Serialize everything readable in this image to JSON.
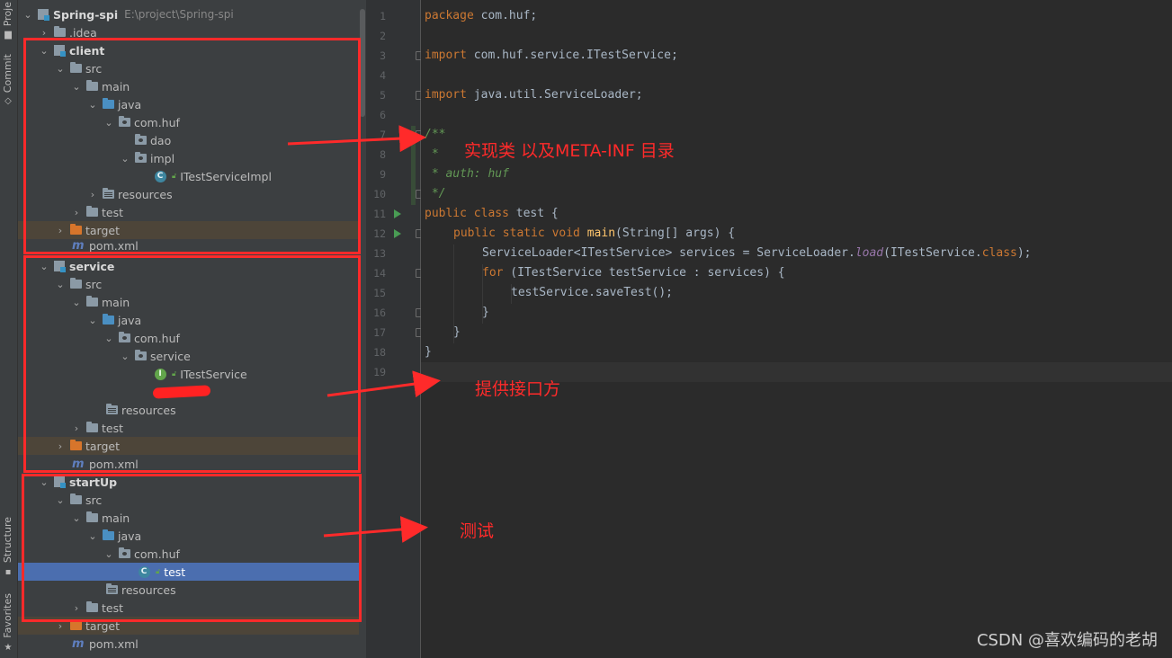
{
  "toolstrip": {
    "project_label": "Proje",
    "commit_label": "Commit",
    "structure_label": "Structure",
    "favorites_label": "Favorites"
  },
  "tree": {
    "root_name": "Spring-spi",
    "root_path": "E:\\project\\Spring-spi",
    "idea": ".idea",
    "client": {
      "name": "client",
      "src": "src",
      "main": "main",
      "java": "java",
      "package": "com.huf",
      "dao": "dao",
      "impl": "impl",
      "impl_class": "ITestServiceImpl",
      "resources": "resources",
      "test": "test",
      "target": "target",
      "pom": "pom.xml"
    },
    "service": {
      "name": "service",
      "src": "src",
      "main": "main",
      "java": "java",
      "package": "com.huf",
      "service_pkg": "service",
      "interface": "ITestService",
      "resources": "resources",
      "test": "test",
      "target": "target",
      "pom": "pom.xml"
    },
    "startup": {
      "name": "startUp",
      "src": "src",
      "main": "main",
      "java": "java",
      "package": "com.huf",
      "test_class": "test",
      "resources": "resources",
      "test": "test",
      "target": "target",
      "pom": "pom.xml"
    }
  },
  "editor": {
    "line_numbers": [
      "1",
      "2",
      "3",
      "4",
      "5",
      "6",
      "7",
      "8",
      "9",
      "10",
      "11",
      "12",
      "13",
      "14",
      "15",
      "16",
      "17",
      "18",
      "19"
    ],
    "code": {
      "l1_kw": "package",
      "l1_rest": " com.huf;",
      "l3_kw": "import",
      "l3_rest": " com.huf.service.ITestService;",
      "l5_kw": "import",
      "l5_rest": " java.util.ServiceLoader;",
      "l7": "/**",
      "l8": " *",
      "l9": " * auth: huf",
      "l10": " */",
      "l11_kw": "public class",
      "l11_rest": " test {",
      "l12_kw": "public static void",
      "l12_fn": "main",
      "l12_rest": "(String[] args) {",
      "l13_a": "ServiceLoader<ITestService> services = ServiceLoader.",
      "l13_m": "load",
      "l13_b": "(ITestService.",
      "l13_kw": "class",
      "l13_c": ");",
      "l14_kw": "for",
      "l14_rest": " (ITestService testService : services) {",
      "l15": "testService.saveTest();",
      "l16": "}",
      "l17": "}",
      "l18": "}"
    }
  },
  "annotations": {
    "note_client": "实现类 以及META-INF 目录",
    "note_service": "提供接口方",
    "note_startup": "测试",
    "color": "#ff2a2a"
  },
  "watermark": "CSDN @喜欢编码的老胡"
}
